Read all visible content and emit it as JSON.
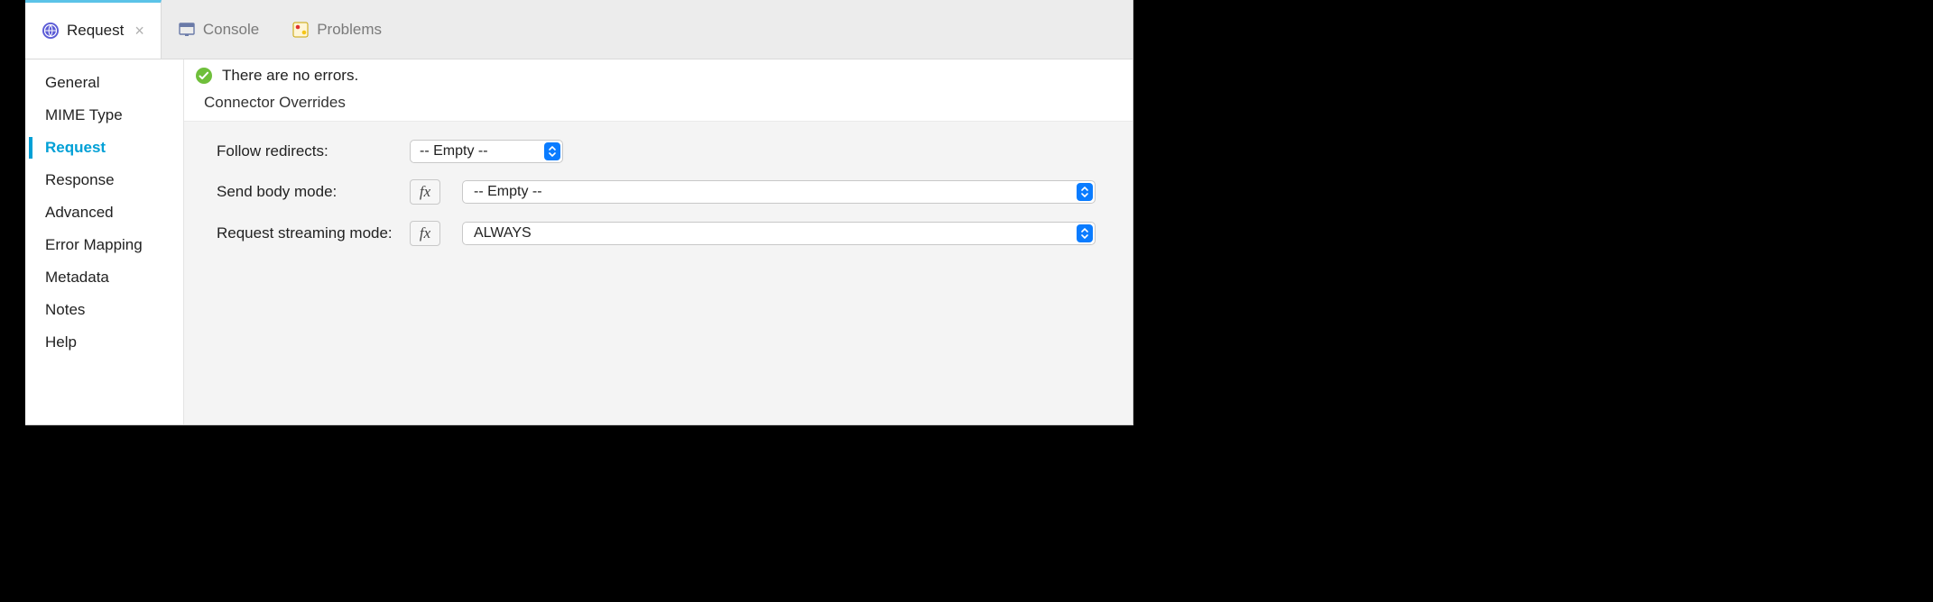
{
  "tabs": [
    {
      "label": "Request",
      "active": true,
      "closable": true,
      "icon": "request"
    },
    {
      "label": "Console",
      "active": false,
      "closable": false,
      "icon": "console"
    },
    {
      "label": "Problems",
      "active": false,
      "closable": false,
      "icon": "problems"
    }
  ],
  "sidebar": {
    "items": [
      {
        "label": "General",
        "active": false
      },
      {
        "label": "MIME Type",
        "active": false
      },
      {
        "label": "Request",
        "active": true
      },
      {
        "label": "Response",
        "active": false
      },
      {
        "label": "Advanced",
        "active": false
      },
      {
        "label": "Error Mapping",
        "active": false
      },
      {
        "label": "Metadata",
        "active": false
      },
      {
        "label": "Notes",
        "active": false
      },
      {
        "label": "Help",
        "active": false
      }
    ]
  },
  "status": {
    "message": "There are no errors."
  },
  "section": {
    "title": "Connector Overrides"
  },
  "fields": {
    "follow_redirects": {
      "label": "Follow redirects:",
      "value": "-- Empty --"
    },
    "send_body_mode": {
      "label": "Send body mode:",
      "value": "-- Empty --"
    },
    "request_streaming": {
      "label": "Request streaming mode:",
      "value": "ALWAYS"
    }
  },
  "fx_label": "fx"
}
